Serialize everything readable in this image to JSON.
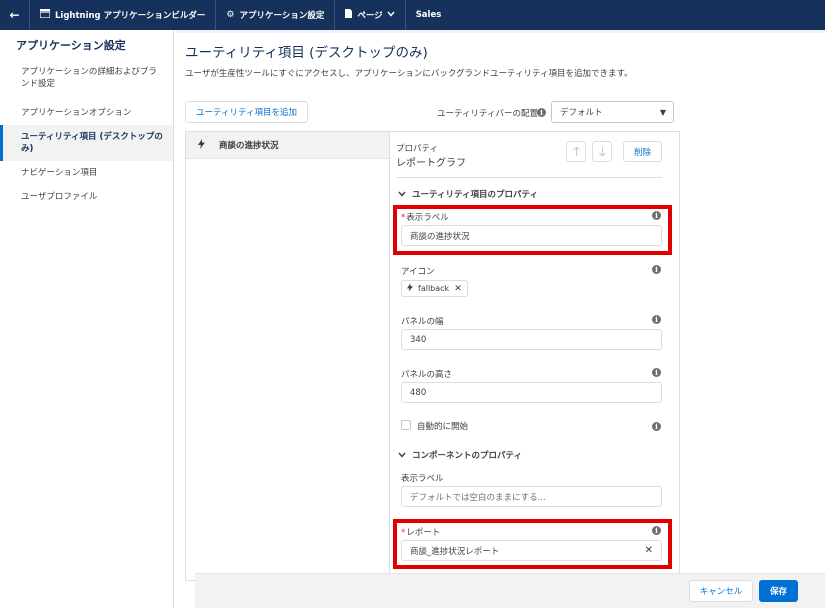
{
  "colors": {
    "topbar": "#16325c",
    "accent": "#0070d2",
    "highlight": "#e00000",
    "required": "#c23934"
  },
  "topbar": {
    "back_icon": "←",
    "builder_label": "Lightning アプリケーションビルダー",
    "settings_label": "アプリケーション設定",
    "pages_label": "ページ",
    "app_name": "Sales"
  },
  "sidebar": {
    "title": "アプリケーション設定",
    "items": [
      {
        "label": "アプリケーションの詳細およびブランド設定"
      },
      {
        "label": "アプリケーションオプション"
      },
      {
        "label": "ユーティリティ項目 (デスクトップのみ)"
      },
      {
        "label": "ナビゲーション項目"
      },
      {
        "label": "ユーザプロファイル"
      }
    ]
  },
  "main": {
    "title": "ユーティリティ項目 (デスクトップのみ)",
    "description": "ユーザが生産性ツールにすぐにアクセスし、アプリケーションにバックグランドユーティリティ項目を追加できます。",
    "add_button": "ユーティリティ項目を追加",
    "placement_label": "ユーティリティバーの配置",
    "placement_value": "デフォルト"
  },
  "utility_list": {
    "items": [
      {
        "label": "商談の進捗状況"
      }
    ]
  },
  "properties": {
    "small_heading": "プロパティ",
    "component_name": "レポートグラフ",
    "delete_button": "削除",
    "utility_section": "ユーティリティ項目のプロパティ",
    "display_label_label": "表示ラベル",
    "display_label_value": "商談の進捗状況",
    "icon_label": "アイコン",
    "icon_value": "fallback",
    "panel_width_label": "パネルの幅",
    "panel_width_value": "340",
    "panel_height_label": "パネルの高さ",
    "panel_height_value": "480",
    "autostart_label": "自動的に開始",
    "component_section": "コンポーネントのプロパティ",
    "comp_label_label": "表示ラベル",
    "comp_label_placeholder": "デフォルトでは空白のままにする...",
    "report_label": "レポート",
    "report_value": "商談_進捗状況レポート"
  },
  "footer": {
    "cancel": "キャンセル",
    "save": "保存"
  }
}
